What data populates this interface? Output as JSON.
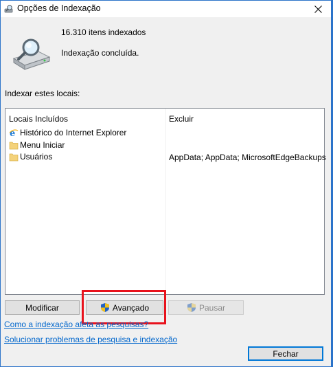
{
  "window": {
    "title": "Opções de Indexação",
    "title_icon": "indexing-options-icon",
    "close_icon": "close-icon"
  },
  "status": {
    "icon": "drive-magnifier-icon",
    "indexed_count": "16.310 itens indexados",
    "state": "Indexação concluída."
  },
  "locations": {
    "section_label": "Indexar estes locais:",
    "columns": {
      "included": "Locais Incluídos",
      "excluded": "Excluir"
    },
    "rows": [
      {
        "name": "Histórico do Internet Explorer",
        "icon": "internet-explorer-icon",
        "exclude": ""
      },
      {
        "name": "Menu Iniciar",
        "icon": "folder-icon",
        "exclude": ""
      },
      {
        "name": "Usuários",
        "icon": "folder-icon",
        "exclude": "AppData; AppData; MicrosoftEdgeBackups"
      }
    ]
  },
  "buttons": {
    "modify": "Modificar",
    "advanced": "Avançado",
    "pause": "Pausar",
    "close": "Fechar"
  },
  "links": {
    "how_indexing_affects": "Como a indexação afeta as pesquisas?",
    "troubleshoot": "Solucionar problemas de pesquisa e indexação"
  },
  "colors": {
    "window_border": "#2b73c9",
    "link": "#0066cc",
    "highlight": "#e8121c",
    "default_button_border": "#0078d7"
  }
}
